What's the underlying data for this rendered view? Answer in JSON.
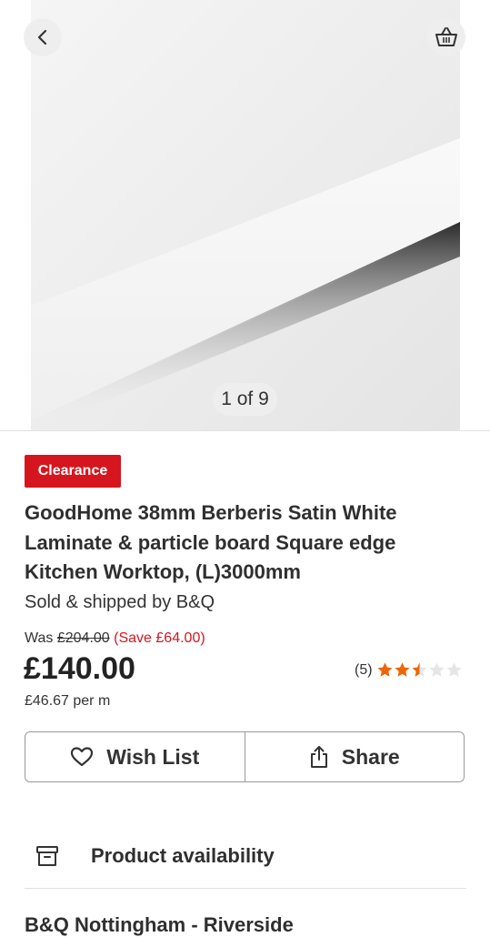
{
  "gallery": {
    "counter": "1 of 9",
    "image_name": "worktop-image"
  },
  "badge": {
    "label": "Clearance",
    "color": "#d5161e"
  },
  "product": {
    "title": "GoodHome 38mm Berberis Satin White Laminate & particle board Square edge Kitchen Worktop, (L)3000mm",
    "seller": "Sold & shipped by B&Q"
  },
  "pricing": {
    "was_label": "Was",
    "was_price": "£204.00",
    "save": "(Save £64.00)",
    "price": "£140.00",
    "unit_price": "£46.67 per m"
  },
  "rating": {
    "count": "(5)",
    "stars": 2.5,
    "max_stars": 5,
    "star_color": "#ec6608"
  },
  "actions": {
    "wishlist_label": "Wish List",
    "share_label": "Share"
  },
  "availability": {
    "label": "Product availability"
  },
  "store": {
    "name": "B&Q Nottingham - Riverside"
  },
  "icons": [
    "chevron-left-icon",
    "basket-icon",
    "heart-icon",
    "share-icon",
    "archive-box-icon",
    "star-icon"
  ]
}
